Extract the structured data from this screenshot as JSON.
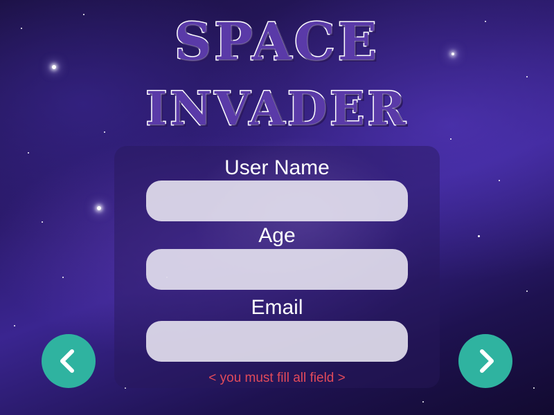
{
  "title": {
    "line1": "SPACE",
    "line2": "INVADER"
  },
  "form": {
    "username": {
      "label": "User Name",
      "value": "",
      "placeholder": ""
    },
    "age": {
      "label": "Age",
      "value": "",
      "placeholder": ""
    },
    "email": {
      "label": "Email",
      "value": "",
      "placeholder": ""
    },
    "warning": "< you must fill all  field >"
  },
  "nav": {
    "prev_icon": "chevron-left-icon",
    "next_icon": "chevron-right-icon"
  },
  "colors": {
    "title_fill": "#5a3aa8",
    "title_stroke": "#ffffff",
    "nav_button": "#2fb3a0",
    "warning_text": "#e24a5a",
    "input_bg": "#e6e2f0"
  }
}
